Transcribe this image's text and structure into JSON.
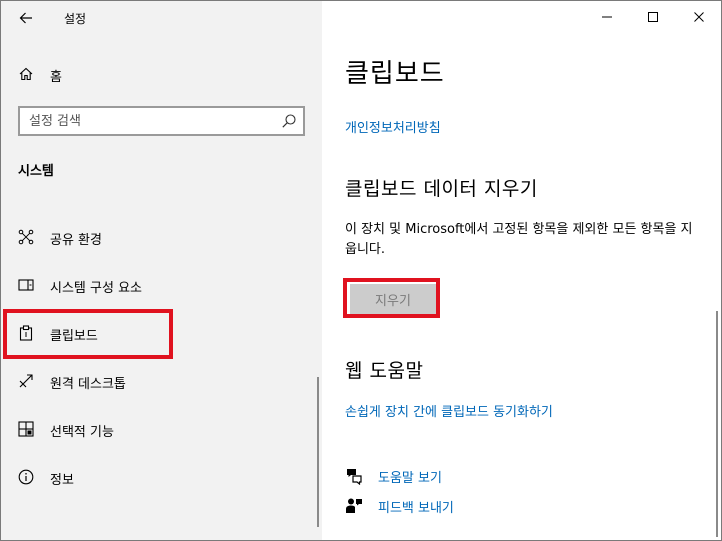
{
  "app": {
    "title": "설정"
  },
  "window_controls": {
    "minimize_icon": "minimize-icon",
    "maximize_icon": "maximize-icon",
    "close_icon": "close-icon"
  },
  "sidebar": {
    "home_label": "홈",
    "search_placeholder": "설정 검색",
    "section_header": "시스템",
    "items": [
      {
        "label": "공유 환경",
        "icon": "share-icon"
      },
      {
        "label": "시스템 구성 요소",
        "icon": "system-components-icon"
      },
      {
        "label": "클립보드",
        "icon": "clipboard-icon",
        "selected": true
      },
      {
        "label": "원격 데스크톱",
        "icon": "remote-desktop-icon"
      },
      {
        "label": "선택적 기능",
        "icon": "optional-features-icon"
      },
      {
        "label": "정보",
        "icon": "info-icon"
      }
    ]
  },
  "main": {
    "page_title": "클립보드",
    "privacy_link": "개인정보처리방침",
    "clear_section": {
      "title": "클립보드 데이터 지우기",
      "description": "이 장치 및 Microsoft에서 고정된 항목을 제외한 모든 항목을 지웁니다.",
      "button_label": "지우기"
    },
    "web_help": {
      "title": "웹 도움말",
      "sync_link": "손쉽게 장치 간에 클립보드 동기화하기"
    },
    "help_links": [
      {
        "label": "도움말 보기",
        "icon": "help-icon"
      },
      {
        "label": "피드백 보내기",
        "icon": "feedback-icon"
      }
    ]
  },
  "colors": {
    "accent_link": "#0067b8",
    "highlight_red": "#e0121f",
    "sidebar_bg": "#f2f2f2"
  }
}
